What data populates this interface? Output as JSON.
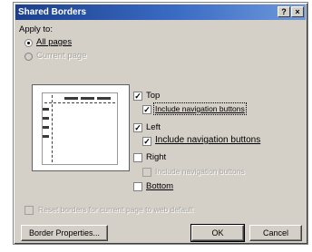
{
  "dialog": {
    "title": "Shared Borders",
    "help_label": "?",
    "close_label": "×"
  },
  "apply_to": {
    "label": "Apply to:",
    "options": [
      "All pages",
      "Current page"
    ],
    "selected": "All pages"
  },
  "borders": {
    "top": {
      "label": "Top",
      "checked": true,
      "include_label": "Include navigation buttons",
      "include_checked": true,
      "include_enabled": true
    },
    "left": {
      "label": "Left",
      "checked": true,
      "include_label": "Include navigation buttons",
      "include_checked": true,
      "include_enabled": true
    },
    "right": {
      "label": "Right",
      "checked": false,
      "include_label": "Include navigation buttons",
      "include_checked": false,
      "include_enabled": false
    },
    "bottom": {
      "label": "Bottom",
      "checked": false
    }
  },
  "reset_option": {
    "label": "Reset borders for current page to web default",
    "checked": false,
    "enabled": false
  },
  "buttons": {
    "border_properties": "Border Properties...",
    "ok": "OK",
    "cancel": "Cancel"
  },
  "check_mark": "✓"
}
